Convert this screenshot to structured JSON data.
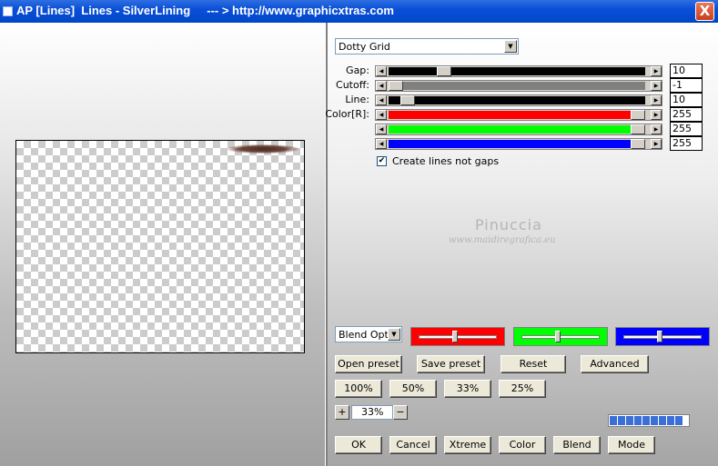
{
  "window": {
    "title": "AP [Lines]  Lines - SilverLining     --- > http://www.graphicxtras.com",
    "close_glyph": "X"
  },
  "preset_select": {
    "value": "Dotty Grid"
  },
  "sliders": [
    {
      "label": "Gap:",
      "value": "10",
      "track_color": "#000000",
      "fill": 0.2
    },
    {
      "label": "Cutoff:",
      "value": "-1",
      "track_color": "#808080",
      "fill": 0.0
    },
    {
      "label": "Line:",
      "value": "10",
      "track_color": "#000000",
      "fill": 0.05
    },
    {
      "label": "Color[R]:",
      "value": "255",
      "track_color": "#ff0000",
      "fill": 1.0
    },
    {
      "label": "",
      "value": "255",
      "track_color": "#00ff00",
      "fill": 1.0
    },
    {
      "label": "",
      "value": "255",
      "track_color": "#0000ff",
      "fill": 1.0
    }
  ],
  "create_lines_checkbox": {
    "label": "Create lines not gaps",
    "checked": true,
    "check_glyph": "✔"
  },
  "watermark": {
    "name": "Pinuccia",
    "url": "www.maidiregrafica.eu"
  },
  "blend_select": {
    "value": "Blend Optio"
  },
  "color_strips": [
    {
      "color": "#ff0000",
      "level": 0.45
    },
    {
      "color": "#00ff00",
      "level": 0.45
    },
    {
      "color": "#0000ff",
      "level": 0.45
    }
  ],
  "buttons_row1": [
    "Open preset",
    "Save preset",
    "Reset",
    "Advanced"
  ],
  "zoom_buttons": [
    "100%",
    "50%",
    "33%",
    "25%"
  ],
  "zoom": {
    "plus": "+",
    "minus": "−",
    "value": "33%"
  },
  "progress": {
    "segments": 9
  },
  "buttons_bottom": [
    "OK",
    "Cancel",
    "Xtreme",
    "Color",
    "Blend",
    "Mode"
  ]
}
